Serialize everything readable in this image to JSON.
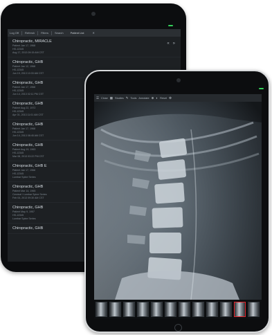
{
  "back_tablet": {
    "toolbar": {
      "items": [
        "Log Off",
        "Refresh",
        "Filters",
        "Search"
      ],
      "tab": "Patient List"
    },
    "nav": [
      "«",
      "»"
    ],
    "patients": [
      {
        "name": "Chiropractic, MIRACLE",
        "lines": [
          "Patient Jan 17, 1968",
          "HS-12345",
          "Aug 17, 2013 09:15 AM CST"
        ]
      },
      {
        "name": "Chiropractic, GHB",
        "lines": [
          "Patient Jan 12, 1968",
          "HS-12345",
          "Jun 19, 2013 10:33 AM CST"
        ]
      },
      {
        "name": "Chiropractic, GHB",
        "lines": [
          "Patient Jan 17, 1968",
          "HS-12345",
          "Jun 14, 2013 02:11 PM CST"
        ]
      },
      {
        "name": "Chiropractic, GHB",
        "lines": [
          "Patient Aug 22, 1972",
          "HS-12345",
          "Apr 01, 2013 11:01 AM CST"
        ]
      },
      {
        "name": "Chiropractic, GHB",
        "lines": [
          "Patient Jan 17, 1968",
          "HS-12345",
          "Jun 14, 2013 08:45 AM CST"
        ]
      },
      {
        "name": "Chiropractic, GHB",
        "lines": [
          "Patient Aug 19, 1963",
          "HS-12345",
          "Mar 08, 2013 03:22 PM CST"
        ]
      },
      {
        "name": "Chiropractic, GHB E",
        "lines": [
          "Patient Jan 17, 1968",
          "HS-12345",
          "Lumbar Spine Series"
        ]
      },
      {
        "name": "Chiropractic, GHB",
        "lines": [
          "Patient Mar 14, 1965",
          "Cervical / Lumbar Spine Series",
          "Feb 04, 2013 09:30 AM CST"
        ]
      },
      {
        "name": "Chiropractic, GHB",
        "lines": [
          "Patient May 9, 1957",
          "HS-12345",
          "Lumbar Spine Series"
        ]
      },
      {
        "name": "Chiropractic, GHB",
        "lines": []
      }
    ]
  },
  "front_tablet": {
    "toolbar": {
      "items": [
        "Close",
        "Studies",
        "Tools",
        "Annotate",
        "Reset"
      ]
    },
    "thumbnails": {
      "count": 12,
      "active_index": 10
    }
  },
  "colors": {
    "accent": "#e2242b",
    "led": "#33d15a"
  }
}
